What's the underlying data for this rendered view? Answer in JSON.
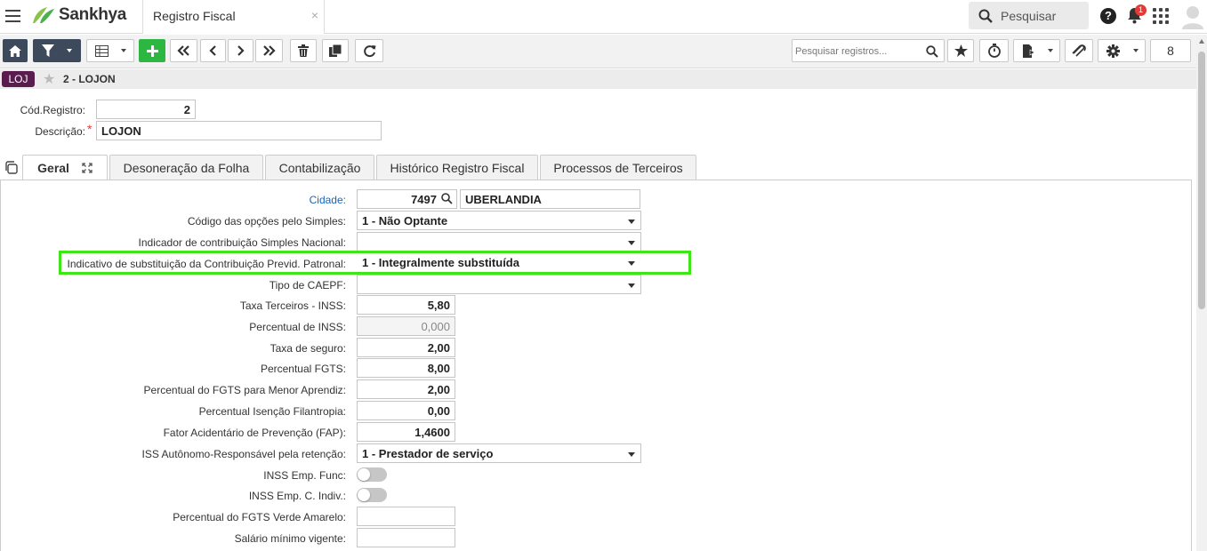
{
  "app": {
    "brand": "Sankhya",
    "tab_title": "Registro Fiscal",
    "tab_close": "×"
  },
  "header": {
    "search_placeholder": "Pesquisar",
    "help": "?",
    "notifications": "1"
  },
  "toolbar": {
    "search_placeholder": "Pesquisar registros...",
    "page": "8"
  },
  "breadcrumb": {
    "badge": "LOJ",
    "title": "2 - LOJON"
  },
  "form": {
    "cod_registro_label": "Cód.Registro:",
    "cod_registro": "2",
    "descricao_label": "Descrição:",
    "descricao_required": "*",
    "descricao": "LOJON"
  },
  "tabs": [
    {
      "label": "Geral"
    },
    {
      "label": "Desoneração da Folha"
    },
    {
      "label": "Contabilização"
    },
    {
      "label": "Histórico Registro Fiscal"
    },
    {
      "label": "Processos de Terceiros"
    }
  ],
  "fields": {
    "cidade_label": "Cidade:",
    "cidade_code": "7497",
    "cidade_name": "UBERLANDIA",
    "simples_label": "Código das opções pelo Simples:",
    "simples": "1 - Não Optante",
    "indicador_simples_label": "Indicador de contribuição Simples Nacional:",
    "indicador_simples": "",
    "indicativo_label": "Indicativo de substituição da Contribuição Previd. Patronal:",
    "indicativo": "1 - Integralmente substituída",
    "caepf_label": "Tipo de CAEPF:",
    "caepf": "",
    "taxa_terceiros_label": "Taxa Terceiros - INSS:",
    "taxa_terceiros": "5,80",
    "perc_inss_label": "Percentual de INSS:",
    "perc_inss": "0,000",
    "taxa_seguro_label": "Taxa de seguro:",
    "taxa_seguro": "2,00",
    "perc_fgts_label": "Percentual FGTS:",
    "perc_fgts": "8,00",
    "perc_fgts_menor_label": "Percentual do FGTS para Menor Aprendiz:",
    "perc_fgts_menor": "2,00",
    "perc_isencao_label": "Percentual Isenção Filantropia:",
    "perc_isencao": "0,00",
    "fap_label": "Fator Acidentário de Prevenção (FAP):",
    "fap": "1,4600",
    "iss_label": "ISS Autônomo-Responsável pela retenção:",
    "iss": "1 - Prestador de serviço",
    "inss_func_label": "INSS Emp. Func:",
    "inss_indiv_label": "INSS Emp. C. Indiv.:",
    "fgts_verde_label": "Percentual do FGTS Verde Amarelo:",
    "fgts_verde": "",
    "salario_label": "Salário mínimo vigente:",
    "salario": ""
  }
}
